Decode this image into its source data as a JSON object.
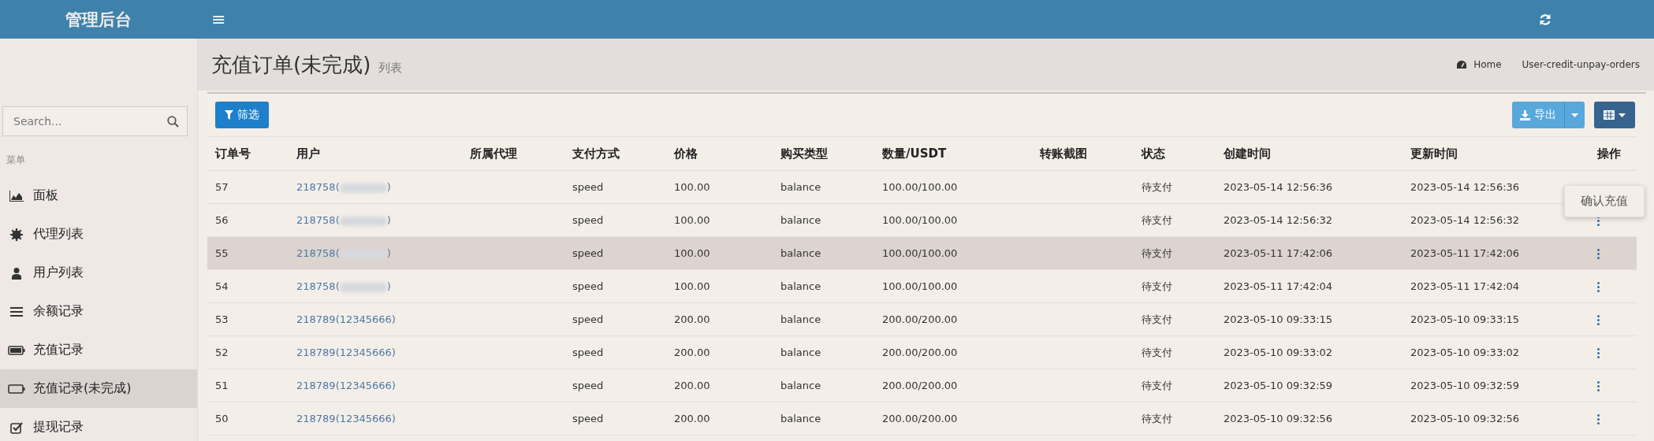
{
  "header": {
    "logo": "管理后台",
    "menu_toggle": "≡"
  },
  "sidebar": {
    "search": {
      "placeholder": "Search..."
    },
    "section_label": "菜单",
    "items": [
      {
        "label": "面板",
        "selected": false
      },
      {
        "label": "代理列表",
        "selected": false
      },
      {
        "label": "用户列表",
        "selected": false
      },
      {
        "label": "余额记录",
        "selected": false
      },
      {
        "label": "充值记录",
        "selected": false
      },
      {
        "label": "充值记录(未完成)",
        "selected": true
      },
      {
        "label": "提现记录",
        "selected": false
      }
    ]
  },
  "page": {
    "title": "充值订单(未完成)",
    "subtitle": "列表",
    "breadcrumb": [
      "Home",
      "User-credit-unpay-orders"
    ]
  },
  "toolbar": {
    "filter_button": "筛选",
    "export_button": "导出"
  },
  "table": {
    "columns": [
      "订单号",
      "用户",
      "所属代理",
      "支付方式",
      "价格",
      "购买类型",
      "数量/USDT",
      "转账截图",
      "状态",
      "创建时间",
      "更新时间",
      "操作"
    ],
    "rows": [
      {
        "id": "57",
        "user": "218758(",
        "user_end": ")",
        "redacted": true,
        "pay": "speed",
        "price": "100.00",
        "type": "balance",
        "qty": "100.00/100.00",
        "status": "待支付",
        "created": "2023-05-14 12:56:36",
        "updated": "2023-05-14 12:56:36",
        "hover": false,
        "menu_open": true
      },
      {
        "id": "56",
        "user": "218758(",
        "user_end": ")",
        "redacted": true,
        "pay": "speed",
        "price": "100.00",
        "type": "balance",
        "qty": "100.00/100.00",
        "status": "待支付",
        "created": "2023-05-14 12:56:32",
        "updated": "2023-05-14 12:56:32",
        "hover": false,
        "menu_open": false
      },
      {
        "id": "55",
        "user": "218758(",
        "user_end": ")",
        "redacted": true,
        "pay": "speed",
        "price": "100.00",
        "type": "balance",
        "qty": "100.00/100.00",
        "status": "待支付",
        "created": "2023-05-11 17:42:06",
        "updated": "2023-05-11 17:42:06",
        "hover": true,
        "menu_open": false
      },
      {
        "id": "54",
        "user": "218758(",
        "user_end": ")",
        "redacted": true,
        "pay": "speed",
        "price": "100.00",
        "type": "balance",
        "qty": "100.00/100.00",
        "status": "待支付",
        "created": "2023-05-11 17:42:04",
        "updated": "2023-05-11 17:42:04",
        "hover": false,
        "menu_open": false
      },
      {
        "id": "53",
        "user": "218789(12345666)",
        "redacted": false,
        "pay": "speed",
        "price": "200.00",
        "type": "balance",
        "qty": "200.00/200.00",
        "status": "待支付",
        "created": "2023-05-10 09:33:15",
        "updated": "2023-05-10 09:33:15",
        "hover": false,
        "menu_open": false
      },
      {
        "id": "52",
        "user": "218789(12345666)",
        "redacted": false,
        "pay": "speed",
        "price": "200.00",
        "type": "balance",
        "qty": "200.00/200.00",
        "status": "待支付",
        "created": "2023-05-10 09:33:02",
        "updated": "2023-05-10 09:33:02",
        "hover": false,
        "menu_open": false
      },
      {
        "id": "51",
        "user": "218789(12345666)",
        "redacted": false,
        "pay": "speed",
        "price": "200.00",
        "type": "balance",
        "qty": "200.00/200.00",
        "status": "待支付",
        "created": "2023-05-10 09:32:59",
        "updated": "2023-05-10 09:32:59",
        "hover": false,
        "menu_open": false
      },
      {
        "id": "50",
        "user": "218789(12345666)",
        "redacted": false,
        "pay": "speed",
        "price": "200.00",
        "type": "balance",
        "qty": "200.00/200.00",
        "status": "待支付",
        "created": "2023-05-10 09:32:56",
        "updated": "2023-05-10 09:32:56",
        "hover": false,
        "menu_open": false
      }
    ],
    "row_menu": [
      "确认充值"
    ]
  }
}
